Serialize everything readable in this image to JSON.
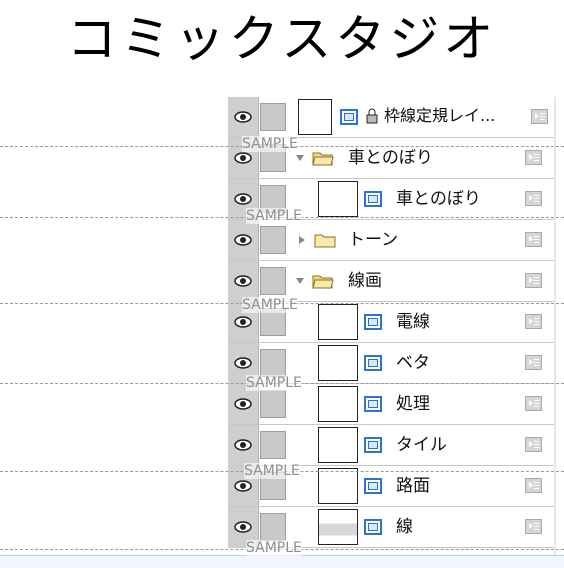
{
  "title": "コミックスタジオ",
  "watermark": "SAMPLE",
  "layers": [
    {
      "name": "枠線定規レイ...",
      "kind": "ruler"
    },
    {
      "name": "車とのぼり",
      "kind": "folder",
      "expanded": true
    },
    {
      "name": "車とのぼり",
      "kind": "layer"
    },
    {
      "name": "トーン",
      "kind": "folder",
      "expanded": false
    },
    {
      "name": "線画",
      "kind": "folder",
      "expanded": true
    },
    {
      "name": "電線",
      "kind": "layer"
    },
    {
      "name": "ベタ",
      "kind": "layer"
    },
    {
      "name": "処理",
      "kind": "layer"
    },
    {
      "name": "タイル",
      "kind": "layer"
    },
    {
      "name": "路面",
      "kind": "layer"
    },
    {
      "name": "線",
      "kind": "layer"
    }
  ],
  "icons": {
    "visibility": "eye-icon",
    "menu": "layer-menu-icon",
    "folder": "folder-icon",
    "layer": "raster-layer-icon"
  }
}
